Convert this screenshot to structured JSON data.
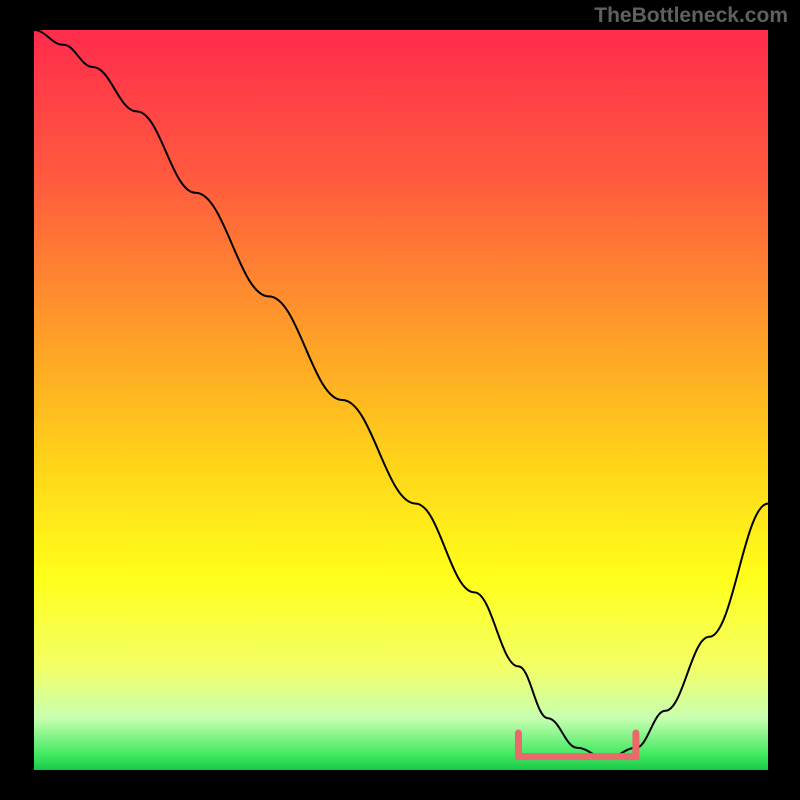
{
  "attribution": "TheBottleneck.com",
  "chart_data": {
    "type": "line",
    "title": "",
    "xlabel": "",
    "ylabel": "",
    "xlim": [
      0,
      100
    ],
    "ylim": [
      0,
      100
    ],
    "background_gradient": {
      "stops": [
        {
          "offset": 0,
          "color": "#ff2c4c"
        },
        {
          "offset": 20,
          "color": "#ff5a3e"
        },
        {
          "offset": 40,
          "color": "#ff9a2a"
        },
        {
          "offset": 58,
          "color": "#ffd21a"
        },
        {
          "offset": 74,
          "color": "#ffff1a"
        },
        {
          "offset": 86,
          "color": "#f3ff66"
        },
        {
          "offset": 93,
          "color": "#c8ffb0"
        },
        {
          "offset": 98,
          "color": "#40e860"
        },
        {
          "offset": 100,
          "color": "#18c848"
        }
      ]
    },
    "series": [
      {
        "name": "bottleneck-curve",
        "stroke": "#000000",
        "x": [
          0,
          4,
          8,
          14,
          22,
          32,
          42,
          52,
          60,
          66,
          70,
          74,
          78,
          82,
          86,
          92,
          100
        ],
        "y": [
          100,
          98,
          95,
          89,
          78,
          64,
          50,
          36,
          24,
          14,
          7,
          3,
          1.5,
          3,
          8,
          18,
          36
        ]
      }
    ],
    "flat_region": {
      "name": "optimal-range-highlight",
      "stroke": "#e86a6a",
      "x_start": 66,
      "x_end": 82,
      "y": 1.8,
      "end_tick_height": 3.2
    }
  }
}
